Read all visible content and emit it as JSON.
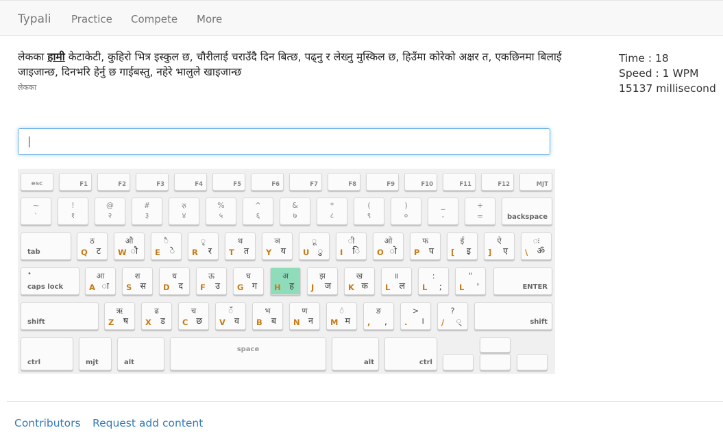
{
  "nav": {
    "brand": "Typali",
    "links": [
      "Practice",
      "Compete",
      "More"
    ]
  },
  "passage": {
    "first_word": "लेकका",
    "highlighted_word": "हामी",
    "rest": "केटाकेटी, कुहिरो भित्र इस्कुल छ, चौरीलाई चराउँदै दिन बित्छ, पढ्नु र लेख्नु मुस्किल छ, हिउँमा कोरेको अक्षर त, एकछिनमा बिलाई जाइजान्छ, दिनभरि हेर्नु छ गाईबस्तु, नहेरे भालुले खाइजान्छ",
    "current_word": "लेकका"
  },
  "stats": {
    "time": "Time : 18",
    "speed": "Speed : 1 WPM",
    "ms": "15137 millisecond"
  },
  "input": {
    "value": ""
  },
  "keyboard": {
    "esc": "esc",
    "fkeys": [
      "F1",
      "F2",
      "F3",
      "F4",
      "F5",
      "F6",
      "F7",
      "F8",
      "F9",
      "F10",
      "F11",
      "F12",
      "MJT"
    ],
    "numrow": [
      {
        "t": "~",
        "b": "`"
      },
      {
        "t": "!",
        "b": "१"
      },
      {
        "t": "@",
        "b": "२"
      },
      {
        "t": "#",
        "b": "३"
      },
      {
        "t": "रु",
        "b": "४"
      },
      {
        "t": "%",
        "b": "५"
      },
      {
        "t": "^",
        "b": "६"
      },
      {
        "t": "&",
        "b": "७"
      },
      {
        "t": "*",
        "b": "८"
      },
      {
        "t": "(",
        "b": "९"
      },
      {
        "t": ")",
        "b": "०"
      },
      {
        "t": "_",
        "b": "-"
      },
      {
        "t": "+",
        "b": "="
      }
    ],
    "backspace": "backspace",
    "tab": "tab",
    "qrow": [
      {
        "t": "ठ",
        "q": "Q",
        "n": "ट"
      },
      {
        "t": "औ",
        "q": "W",
        "n": "ौ"
      },
      {
        "t": "ै",
        "q": "E",
        "n": "े"
      },
      {
        "t": "ृ",
        "q": "R",
        "n": "र"
      },
      {
        "t": "थ",
        "q": "T",
        "n": "त"
      },
      {
        "t": "ञ",
        "q": "Y",
        "n": "य"
      },
      {
        "t": "ू",
        "q": "U",
        "n": "ु"
      },
      {
        "t": "ी",
        "q": "I",
        "n": "ि"
      },
      {
        "t": "ओ",
        "q": "O",
        "n": "ो"
      },
      {
        "t": "फ",
        "q": "P",
        "n": "प"
      },
      {
        "t": "ई",
        "q": "[",
        "n": "इ"
      },
      {
        "t": "ऐ",
        "q": "]",
        "n": "ए"
      },
      {
        "t": "ः",
        "q": "\\",
        "n": "ॐ"
      }
    ],
    "caps_dot": "•",
    "caps": "caps lock",
    "arow": [
      {
        "t": "आ",
        "q": "A",
        "n": "ा"
      },
      {
        "t": "श",
        "q": "S",
        "n": "स"
      },
      {
        "t": "ध",
        "q": "D",
        "n": "द"
      },
      {
        "t": "ऊ",
        "q": "F",
        "n": "उ"
      },
      {
        "t": "घ",
        "q": "G",
        "n": "ग"
      },
      {
        "t": "अ",
        "q": "H",
        "n": "ह",
        "active": true
      },
      {
        "t": "झ",
        "q": "J",
        "n": "ज"
      },
      {
        "t": "ख",
        "q": "K",
        "n": "क"
      },
      {
        "t": "॥",
        "q": "L",
        "n": "ल"
      },
      {
        "t": ":",
        "q": "L",
        "n": ";"
      },
      {
        "t": "\"",
        "q": "L",
        "n": "'"
      }
    ],
    "enter": "ENTER",
    "shift": "shift",
    "zrow": [
      {
        "t": "ऋ",
        "q": "Z",
        "n": "ष"
      },
      {
        "t": "ढ",
        "q": "X",
        "n": "ड"
      },
      {
        "t": "च",
        "q": "C",
        "n": "छ"
      },
      {
        "t": "ँ",
        "q": "V",
        "n": "व"
      },
      {
        "t": "भ",
        "q": "B",
        "n": "ब"
      },
      {
        "t": "ण",
        "q": "N",
        "n": "न"
      },
      {
        "t": "ं",
        "q": "M",
        "n": "म"
      },
      {
        "t": "ङ",
        "q": ",",
        "n": ","
      },
      {
        "t": ">",
        "q": ".",
        "n": "।"
      },
      {
        "t": "?",
        "q": "/",
        "n": "्"
      }
    ],
    "ctrl": "ctrl",
    "mjt": "mjt",
    "alt": "alt",
    "space": "space"
  },
  "footer": {
    "contributors": "Contributors",
    "request": "Request add content"
  },
  "colors": {
    "accent_link": "#337ab7",
    "qwerty_letter": "#c87a12",
    "active_key": "#8fdcbb",
    "input_focus": "#66afe9"
  }
}
